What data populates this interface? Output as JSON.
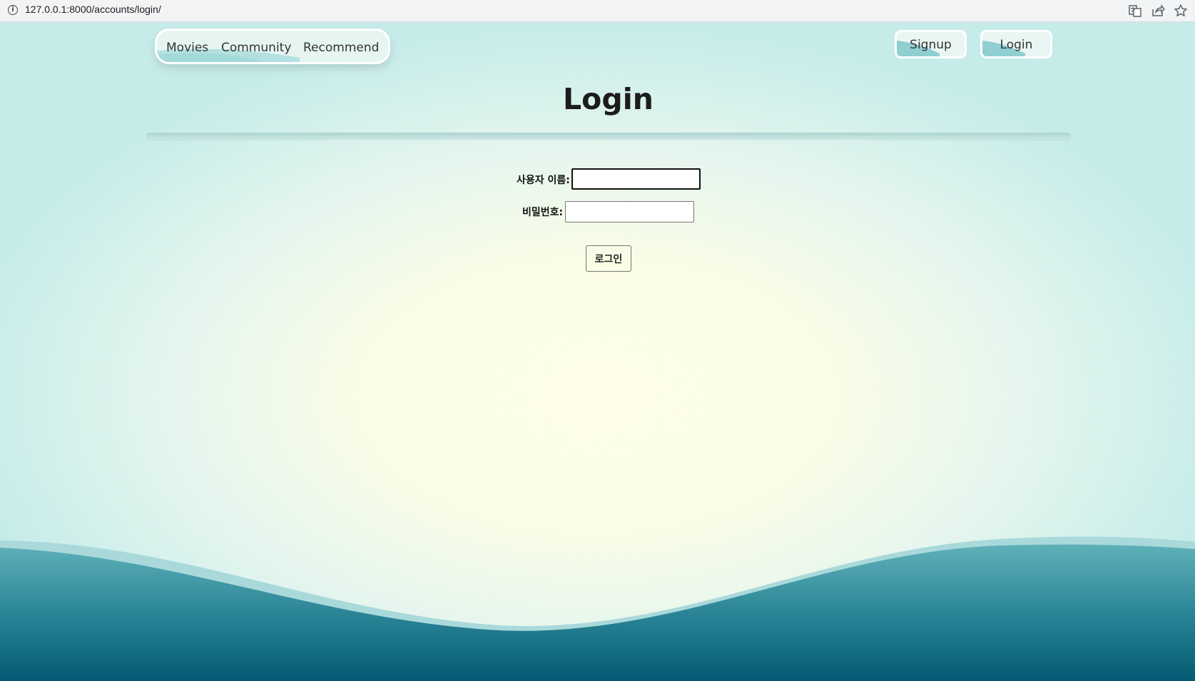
{
  "browser": {
    "url": "127.0.0.1:8000/accounts/login/",
    "icons": [
      "info-icon",
      "translate-icon",
      "share-icon",
      "bookmark-star-icon"
    ]
  },
  "nav": {
    "links": [
      {
        "label": "Movies"
      },
      {
        "label": "Community"
      },
      {
        "label": "Recommend"
      }
    ],
    "signup_label": "Signup",
    "login_label": "Login"
  },
  "page": {
    "title": "Login"
  },
  "form": {
    "username_label": "사용자 이름:",
    "username_value": "",
    "password_label": "비밀번호:",
    "password_value": "",
    "submit_label": "로그인"
  },
  "colors": {
    "background_center": "#fefee8",
    "background_edge": "#c6ecea",
    "wave_dark": "#045a72",
    "wave_light": "#7fc6c9",
    "nav_accent": "#8fcfd1"
  }
}
